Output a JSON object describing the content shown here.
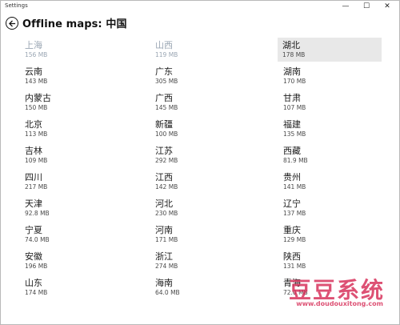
{
  "window": {
    "title": "Settings",
    "minimize_glyph": "—",
    "maximize_glyph": "☐",
    "close_glyph": "✕"
  },
  "header": {
    "title": "Offline maps: 中国",
    "back_icon": "back-arrow-icon"
  },
  "regions": [
    [
      {
        "name": "上海",
        "size": "156 MB",
        "state": "dim"
      },
      {
        "name": "云南",
        "size": "143 MB"
      },
      {
        "name": "内蒙古",
        "size": "150 MB"
      },
      {
        "name": "北京",
        "size": "113 MB"
      },
      {
        "name": "吉林",
        "size": "109 MB"
      },
      {
        "name": "四川",
        "size": "217 MB"
      },
      {
        "name": "天津",
        "size": "92.8 MB"
      },
      {
        "name": "宁夏",
        "size": "74.0 MB"
      },
      {
        "name": "安徽",
        "size": "196 MB"
      },
      {
        "name": "山东",
        "size": "174 MB"
      }
    ],
    [
      {
        "name": "山西",
        "size": "119 MB",
        "state": "dim"
      },
      {
        "name": "广东",
        "size": "305 MB"
      },
      {
        "name": "广西",
        "size": "145 MB"
      },
      {
        "name": "新疆",
        "size": "100 MB"
      },
      {
        "name": "江苏",
        "size": "292 MB"
      },
      {
        "name": "江西",
        "size": "142 MB"
      },
      {
        "name": "河北",
        "size": "230 MB"
      },
      {
        "name": "河南",
        "size": "171 MB"
      },
      {
        "name": "浙江",
        "size": "274 MB"
      },
      {
        "name": "海南",
        "size": "64.0 MB"
      }
    ],
    [
      {
        "name": "湖北",
        "size": "178 MB",
        "state": "selected"
      },
      {
        "name": "湖南",
        "size": "170 MB"
      },
      {
        "name": "甘肃",
        "size": "107 MB"
      },
      {
        "name": "福建",
        "size": "135 MB"
      },
      {
        "name": "西藏",
        "size": "81.9 MB"
      },
      {
        "name": "贵州",
        "size": "141 MB"
      },
      {
        "name": "辽宁",
        "size": "137 MB"
      },
      {
        "name": "重庆",
        "size": "129 MB"
      },
      {
        "name": "陕西",
        "size": "131 MB"
      },
      {
        "name": "青海",
        "size": "72.0 MB"
      }
    ]
  ],
  "watermark": {
    "title": "豆豆系统",
    "url": "www.doudouxitong.com"
  },
  "colors": {
    "dim_text": "#9aa6b3",
    "selected_bg": "#e8e8e8",
    "watermark": "#d8335c"
  }
}
